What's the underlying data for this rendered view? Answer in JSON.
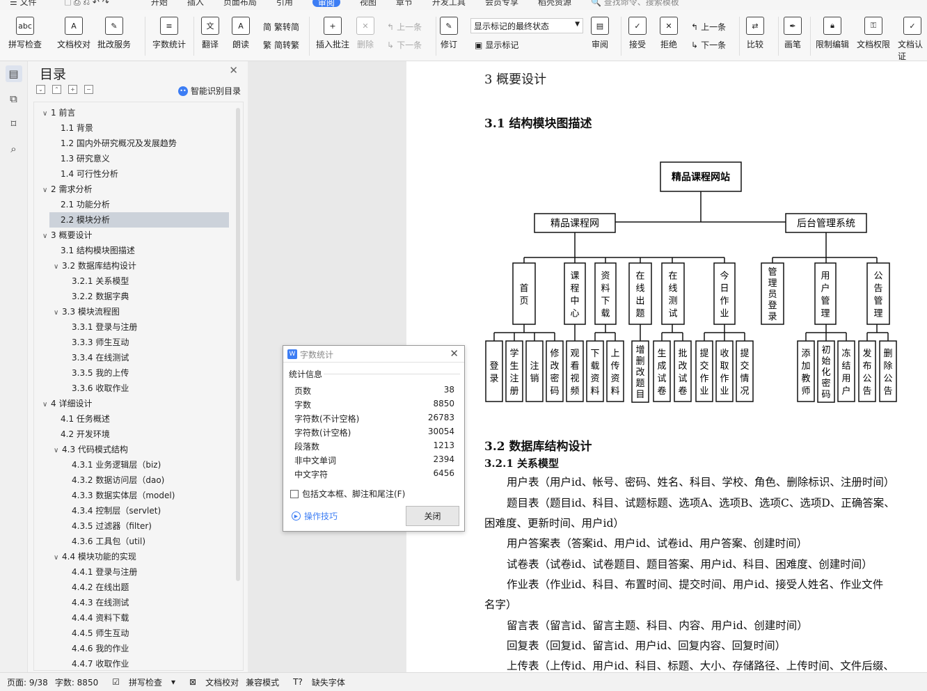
{
  "menu": {
    "file": "文件",
    "tabs": [
      "开始",
      "插入",
      "页面布局",
      "引用",
      "审阅",
      "视图",
      "章节",
      "开发工具",
      "会员专享",
      "稻壳资源"
    ],
    "active_tab": "审阅",
    "search": "查找命令、搜索模板"
  },
  "ribbon": {
    "spell": "拼写检查",
    "proof": "文档校对",
    "annotate_service": "批改服务",
    "wordcount": "字数统计",
    "translate": "翻译",
    "read": "朗读",
    "trad": "繁转简",
    "simp": "简转繁",
    "insert_comment": "插入批注",
    "delete": "删除",
    "prev": "上一条",
    "next": "下一条",
    "revise": "修订",
    "combo_value": "显示标记的最终状态",
    "show_marks": "显示标记",
    "review": "审阅",
    "accept": "接受",
    "reject": "拒绝",
    "prev2": "上一条",
    "next2": "下一条",
    "compare": "比较",
    "pen": "画笔",
    "restrict": "限制编辑",
    "perm": "文档权限",
    "cert": "文档认证"
  },
  "toc": {
    "title": "目录",
    "smart": "智能识别目录",
    "items": [
      {
        "text": "1   前言",
        "level": 0,
        "caret": "∨"
      },
      {
        "text": "1.1 背景",
        "level": 1
      },
      {
        "text": "1.2 国内外研究概况及发展趋势",
        "level": 1
      },
      {
        "text": "1.3 研究意义",
        "level": 1
      },
      {
        "text": "1.4 可行性分析",
        "level": 1
      },
      {
        "text": "2   需求分析",
        "level": 0,
        "caret": "∨"
      },
      {
        "text": "2.1 功能分析",
        "level": 1
      },
      {
        "text": "2.2  模块分析",
        "level": 1,
        "active": true
      },
      {
        "text": "3   概要设计",
        "level": 0,
        "caret": "∨"
      },
      {
        "text": "3.1  结构模块图描述",
        "level": 1
      },
      {
        "text": "3.2 数据库结构设计",
        "level": 1,
        "caret": "∨"
      },
      {
        "text": "3.2.1  关系模型",
        "level": 2
      },
      {
        "text": "3.2.2  数据字典",
        "level": 2
      },
      {
        "text": "3.3 模块流程图",
        "level": 1,
        "caret": "∨"
      },
      {
        "text": "3.3.1  登录与注册",
        "level": 2
      },
      {
        "text": "3.3.3  师生互动",
        "level": 2
      },
      {
        "text": "3.3.4  在线测试",
        "level": 2
      },
      {
        "text": "3.3.5  我的上传",
        "level": 2
      },
      {
        "text": "3.3.6  收取作业",
        "level": 2
      },
      {
        "text": "4   详细设计",
        "level": 0,
        "caret": "∨"
      },
      {
        "text": "4.1 任务概述",
        "level": 1
      },
      {
        "text": "4.2 开发环境",
        "level": 1
      },
      {
        "text": "4.3 代码模式结构",
        "level": 1,
        "caret": "∨"
      },
      {
        "text": "4.3.1  业务逻辑层（biz)",
        "level": 2
      },
      {
        "text": "4.3.2  数据访问层（dao)",
        "level": 2
      },
      {
        "text": "4.3.3  数据实体层（model)",
        "level": 2
      },
      {
        "text": "4.3.4  控制层（servlet)",
        "level": 2
      },
      {
        "text": "4.3.5  过滤器（filter)",
        "level": 2
      },
      {
        "text": "4.3.6  工具包（util)",
        "level": 2
      },
      {
        "text": "4.4 模块功能的实现",
        "level": 1,
        "caret": "∨"
      },
      {
        "text": "4.4.1  登录与注册",
        "level": 2
      },
      {
        "text": "4.4.2  在线出题",
        "level": 2
      },
      {
        "text": "4.4.3  在线测试",
        "level": 2
      },
      {
        "text": "4.4.4  资料下载",
        "level": 2
      },
      {
        "text": "4.4.5  师生互动",
        "level": 2
      },
      {
        "text": "4.4.6  我的作业",
        "level": 2
      },
      {
        "text": "4.4.7  收取作业",
        "level": 2
      }
    ]
  },
  "doc": {
    "h1": "3   概要设计",
    "h2a": "3.1  结构模块图描述",
    "h2b": "3.2 数据库结构设计",
    "h3": "3.2.1 关系模型",
    "paras": [
      "用户表（用户id、帐号、密码、姓名、科目、学校、角色、删除标识、注册时间）",
      "题目表（题目id、科目、试题标题、选项A、选项B、选项C、选项D、正确答案、",
      "困难度、更新时间、用户id）",
      "用户答案表（答案id、用户id、试卷id、用户答案、创建时间）",
      "试卷表（试卷id、试卷题目、题目答案、用户id、科目、困难度、创建时间）",
      "作业表（作业id、科目、布置时间、提交时间、用户id、接受人姓名、作业文件",
      "名字）",
      "留言表（留言id、留言主题、科目、内容、用户id、创建时间）",
      "回复表（回复id、留言id、用户id、回复内容、回复时间）",
      "上传表（上传id、用户id、科目、标题、大小、存储路径、上传时间、文件后缀、"
    ],
    "diagram": {
      "root": "精品课程网站",
      "left": "精品课程网",
      "right": "后台管理系统",
      "mid": [
        "首页",
        "课程中心",
        "资料下载",
        "在线出题",
        "在线测试",
        "今日作业",
        "管理员登录",
        "用户管理",
        "公告管理"
      ],
      "leaves": [
        "登录",
        "学生注册",
        "注销",
        "修改密码",
        "观看视频",
        "下载资料",
        "上传资料",
        "增删改题目",
        "生成试卷",
        "批改试卷",
        "提交作业",
        "收取作业",
        "提交情况",
        "添加教师",
        "初始化密码",
        "冻结用户",
        "发布公告",
        "删除公告"
      ]
    }
  },
  "dialog": {
    "title": "字数统计",
    "section": "统计信息",
    "stats": [
      {
        "label": "页数",
        "value": "38"
      },
      {
        "label": "字数",
        "value": "8850"
      },
      {
        "label": "字符数(不计空格)",
        "value": "26783"
      },
      {
        "label": "字符数(计空格)",
        "value": "30054"
      },
      {
        "label": "段落数",
        "value": "1213"
      },
      {
        "label": "非中文单词",
        "value": "2394"
      },
      {
        "label": "中文字符",
        "value": "6456"
      }
    ],
    "checkbox": "包括文本框、脚注和尾注(F)",
    "tips": "操作技巧",
    "close": "关闭"
  },
  "status": {
    "page": "页面: 9/38",
    "words": "字数: 8850",
    "spell": "拼写检查",
    "proof": "文档校对",
    "compat": "兼容模式",
    "font": "缺失字体"
  }
}
